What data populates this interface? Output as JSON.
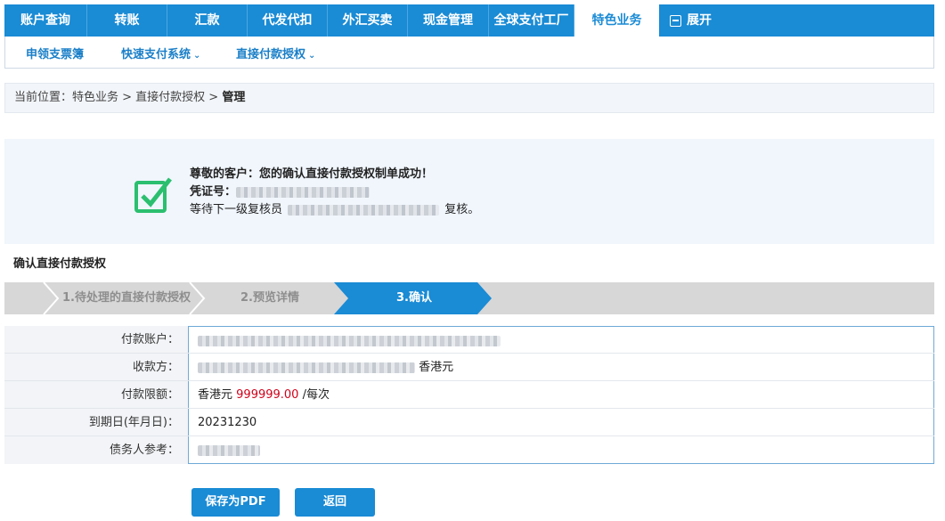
{
  "topnav": {
    "tabs": [
      {
        "label": "账户查询"
      },
      {
        "label": "转账"
      },
      {
        "label": "汇款"
      },
      {
        "label": "代发代扣"
      },
      {
        "label": "外汇买卖"
      },
      {
        "label": "现金管理"
      },
      {
        "label": "全球支付工厂"
      },
      {
        "label": "特色业务"
      }
    ],
    "active": "特色业务",
    "expand_label": "展开"
  },
  "subnav": {
    "items": [
      {
        "label": "申领支票簿"
      },
      {
        "label": "快速支付系统"
      },
      {
        "label": "直接付款授权"
      }
    ]
  },
  "breadcrumb": {
    "prefix": "当前位置：特色业务 > 直接付款授权 > ",
    "current": "管理"
  },
  "success": {
    "title": "尊敬的客户：您的确认直接付款授权制单成功！",
    "voucher_label": "凭证号：",
    "waiting_prefix": "等待下一级复核员",
    "waiting_suffix": "复核。",
    "icon": "check-box-icon",
    "accent": "#2bbf6f"
  },
  "section_title": "确认直接付款授权",
  "steps": [
    {
      "label": "1.待处理的直接付款授权",
      "state": "done"
    },
    {
      "label": "2.预览详情",
      "state": "done"
    },
    {
      "label": "3.确认",
      "state": "active"
    }
  ],
  "form": {
    "payer_account": {
      "label": "付款账户："
    },
    "payee": {
      "label": "收款方：",
      "currency": "香港元"
    },
    "limit": {
      "label": "付款限额：",
      "currency": "香港元",
      "amount": "999999.00",
      "unit": "/每次"
    },
    "expiry": {
      "label": "到期日(年月日)：",
      "value": "20231230"
    },
    "debtor_ref": {
      "label": "债务人参考："
    }
  },
  "buttons": {
    "save_pdf": "保存为PDF",
    "back": "返回"
  },
  "colors": {
    "primary": "#1a8bd5",
    "amount": "#d0021b",
    "step_inactive": "#d7d7d7"
  }
}
